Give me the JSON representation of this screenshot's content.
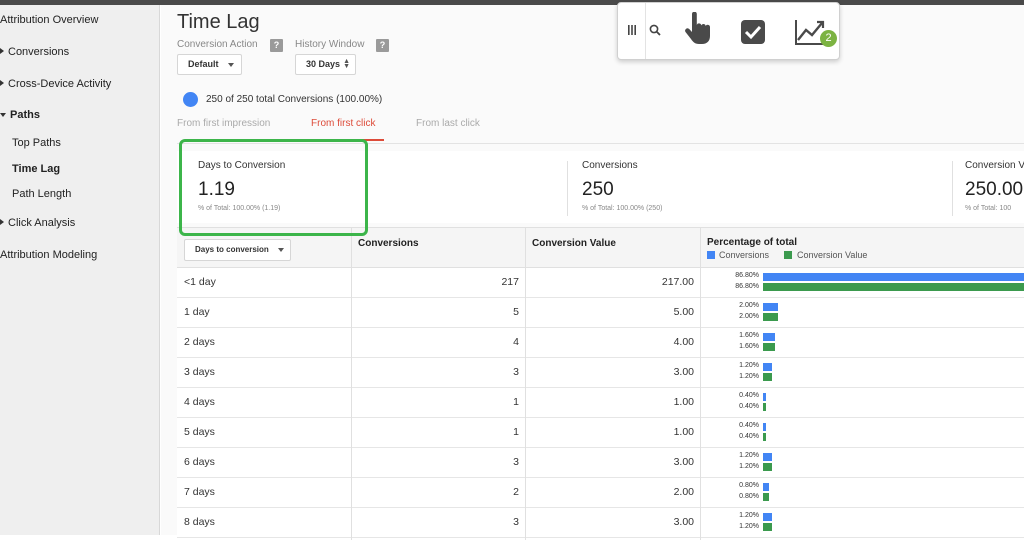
{
  "sidebar": {
    "attribution_overview": "Attribution Overview",
    "conversions": "Conversions",
    "cross_device": "Cross-Device Activity",
    "paths": "Paths",
    "top_paths": "Top Paths",
    "time_lag": "Time Lag",
    "path_length": "Path Length",
    "click_analysis": "Click Analysis",
    "attribution_modeling": "Attribution Modeling"
  },
  "header": {
    "title": "Time Lag",
    "conversion_action_label": "Conversion Action",
    "conversion_action_value": "Default",
    "history_window_label": "History Window",
    "history_window_value": "30 Days",
    "help_glyph": "?"
  },
  "summary": {
    "text": "250 of 250 total Conversions (100.00%)",
    "dot_color": "#4285f4"
  },
  "tabs": {
    "first_impression": "From first impression",
    "first_click": "From first click",
    "last_click": "From last click"
  },
  "scorecards": [
    {
      "label": "Days to Conversion",
      "value": "1.19",
      "sub": "% of Total: 100.00% (1.19)"
    },
    {
      "label": "Conversions",
      "value": "250",
      "sub": "% of Total: 100.00% (250)"
    },
    {
      "label": "Conversion V",
      "value": "250.00",
      "sub": "% of Total: 100"
    }
  ],
  "table": {
    "dimension_select": "Days to conversion",
    "headers": {
      "conversions": "Conversions",
      "value": "Conversion Value",
      "pct": "Percentage of total"
    },
    "legend": {
      "conversions": "Conversions",
      "value": "Conversion Value"
    },
    "colors": {
      "conversions": "#4285f4",
      "value": "#3b9a4e"
    },
    "rows": [
      {
        "label": "<1 day",
        "conversions": "217",
        "value": "217.00",
        "pct_conv": "86.80%",
        "pct_val": "86.80%",
        "share": 0.868
      },
      {
        "label": "1 day",
        "conversions": "5",
        "value": "5.00",
        "pct_conv": "2.00%",
        "pct_val": "2.00%",
        "share": 0.02
      },
      {
        "label": "2 days",
        "conversions": "4",
        "value": "4.00",
        "pct_conv": "1.60%",
        "pct_val": "1.60%",
        "share": 0.016
      },
      {
        "label": "3 days",
        "conversions": "3",
        "value": "3.00",
        "pct_conv": "1.20%",
        "pct_val": "1.20%",
        "share": 0.012
      },
      {
        "label": "4 days",
        "conversions": "1",
        "value": "1.00",
        "pct_conv": "0.40%",
        "pct_val": "0.40%",
        "share": 0.004
      },
      {
        "label": "5 days",
        "conversions": "1",
        "value": "1.00",
        "pct_conv": "0.40%",
        "pct_val": "0.40%",
        "share": 0.004
      },
      {
        "label": "6 days",
        "conversions": "3",
        "value": "3.00",
        "pct_conv": "1.20%",
        "pct_val": "1.20%",
        "share": 0.012
      },
      {
        "label": "7 days",
        "conversions": "2",
        "value": "2.00",
        "pct_conv": "0.80%",
        "pct_val": "0.80%",
        "share": 0.008
      },
      {
        "label": "8 days",
        "conversions": "3",
        "value": "3.00",
        "pct_conv": "1.20%",
        "pct_val": "1.20%",
        "share": 0.012
      }
    ]
  },
  "toolbar": {
    "icons": [
      "columns-icon",
      "search-icon",
      "pointer-hand-icon",
      "checkbox-icon",
      "trend-chart-icon"
    ],
    "badge_count": "2",
    "badge_color": "#7cb342"
  }
}
